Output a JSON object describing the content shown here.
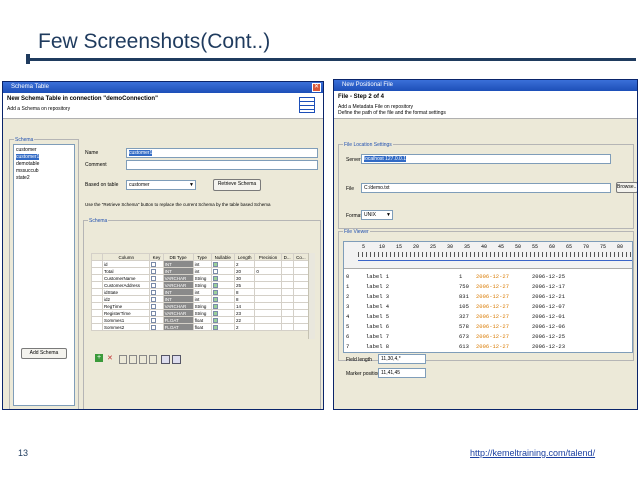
{
  "slide": {
    "title": "Few Screenshots(Cont..)",
    "number": "13",
    "link": "http://kemeltraining.com/talend/"
  },
  "schema_window": {
    "title": "Schema Table",
    "header_title": "New Schema Table in connection \"demoConnection\"",
    "header_sub": "Add a Schema on repository",
    "group_label": "Schema",
    "schemas": [
      "customer",
      "customer1",
      "demotable",
      "mssuccub",
      "state2"
    ],
    "selected_schema_index": 1,
    "name_label": "Name",
    "name_value": "customer1",
    "comment_label": "Comment",
    "based_label": "Based on table",
    "based_value": "customer",
    "retrieve_button": "Retrieve Schema",
    "hint": "Use the \"Retrieve Schema\" button to replace the current Schema by the table based Schema",
    "schema_group_label": "Schema",
    "columns": [
      "Column",
      "Key",
      "DB Type",
      "Type",
      "Nullable",
      "Length",
      "Precision",
      "D...",
      "Co..."
    ],
    "rows": [
      {
        "column": "id",
        "key": false,
        "dbtype": "INT",
        "type": "int",
        "nullable": true,
        "length": "2",
        "precision": ""
      },
      {
        "column": "Total",
        "key": false,
        "dbtype": "INT",
        "type": "int",
        "nullable": false,
        "length": "20",
        "precision": "0"
      },
      {
        "column": "CustomerName",
        "key": false,
        "dbtype": "VARCHAR",
        "type": "String",
        "nullable": true,
        "length": "30",
        "precision": ""
      },
      {
        "column": "CustomerAddress",
        "key": false,
        "dbtype": "VARCHAR",
        "type": "String",
        "nullable": true,
        "length": "25",
        "precision": ""
      },
      {
        "column": "idState",
        "key": false,
        "dbtype": "INT",
        "type": "int",
        "nullable": true,
        "length": "8",
        "precision": ""
      },
      {
        "column": "id2",
        "key": false,
        "dbtype": "INT",
        "type": "int",
        "nullable": true,
        "length": "8",
        "precision": ""
      },
      {
        "column": "RegTime",
        "key": false,
        "dbtype": "VARCHAR",
        "type": "String",
        "nullable": true,
        "length": "14",
        "precision": ""
      },
      {
        "column": "RegisterTime",
        "key": false,
        "dbtype": "VARCHAR",
        "type": "String",
        "nullable": true,
        "length": "23",
        "precision": ""
      },
      {
        "column": "Sommes1",
        "key": false,
        "dbtype": "FLOAT",
        "type": "float",
        "nullable": true,
        "length": "22",
        "precision": ""
      },
      {
        "column": "Sommes2",
        "key": false,
        "dbtype": "FLOAT",
        "type": "float",
        "nullable": true,
        "length": "2",
        "precision": ""
      }
    ],
    "add_schema_button": "Add Schema",
    "toolbar_icons": [
      "add-icon",
      "delete-icon",
      "copy-icon",
      "paste-icon",
      "move-up-icon",
      "move-down-icon",
      "import-icon",
      "export-icon"
    ]
  },
  "positional_window": {
    "title": "New Positional File",
    "step_title": "File - Step 2 of 4",
    "header_sub1": "Add a Metadata File on repository",
    "header_sub2": "Define the path of the file and the format settings",
    "location_group": "File Location Settings",
    "server_label": "Server",
    "server_value": "localhost 127.0.0.1",
    "file_label": "File",
    "file_value": "C:/demo.txt",
    "browse_button": "Browse...",
    "format_label": "Format",
    "format_value": "UNIX",
    "viewer_group": "File Viewer",
    "ruler": [
      "5",
      "10",
      "15",
      "20",
      "25",
      "30",
      "35",
      "40",
      "45",
      "50",
      "55",
      "60",
      "65",
      "70",
      "75",
      "80"
    ],
    "lines": [
      {
        "num": "0",
        "a": "label 1",
        "b": "1",
        "c": "2006-12-27",
        "d": "2006-12-25"
      },
      {
        "num": "1",
        "a": "label 2",
        "b": "750",
        "c": "2006-12-27",
        "d": "2006-12-17"
      },
      {
        "num": "2",
        "a": "label 3",
        "b": "831",
        "c": "2006-12-27",
        "d": "2006-12-21"
      },
      {
        "num": "3",
        "a": "label 4",
        "b": "105",
        "c": "2006-12-27",
        "d": "2006-12-07"
      },
      {
        "num": "4",
        "a": "label 5",
        "b": "327",
        "c": "2006-12-27",
        "d": "2006-12-01"
      },
      {
        "num": "5",
        "a": "label 6",
        "b": "578",
        "c": "2006-12-27",
        "d": "2006-12-06"
      },
      {
        "num": "6",
        "a": "label 7",
        "b": "673",
        "c": "2006-12-27",
        "d": "2006-12-25"
      },
      {
        "num": "7",
        "a": "label 8",
        "b": "613",
        "c": "2006-12-27",
        "d": "2006-12-23"
      }
    ],
    "field_length_label": "Field length",
    "field_length_value": "11,30,4,*",
    "marker_label": "Marker position",
    "marker_value": "11,41,45"
  },
  "colors": {
    "title": "#1f3b5e",
    "titlebar": "#1d4fb8",
    "dialog": "#ece9d8",
    "selection": "#316ac5",
    "marker": "#d97a00"
  }
}
